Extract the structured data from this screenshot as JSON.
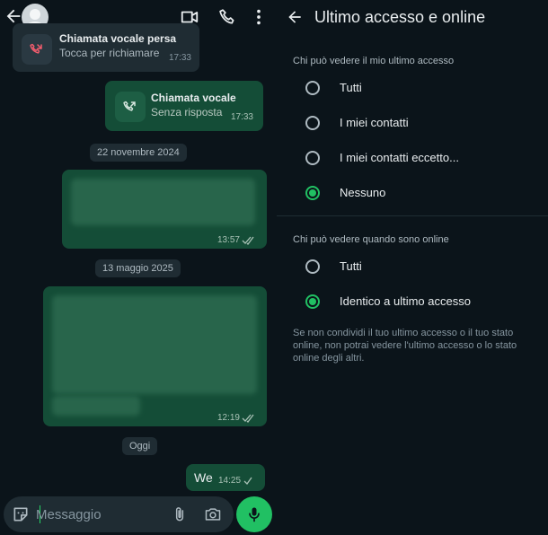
{
  "chat": {
    "missed_call": {
      "title": "Chiamata vocale persa",
      "subtitle": "Tocca per richiamare",
      "time": "17:33"
    },
    "voice_call": {
      "title": "Chiamata vocale",
      "subtitle": "Senza risposta",
      "time": "17:33"
    },
    "date1": "22 novembre 2024",
    "msg1_time": "13:57",
    "date2": "13 maggio 2025",
    "msg2_time": "12:19",
    "date3": "Oggi",
    "msg3": {
      "text": "We",
      "time": "14:25"
    },
    "composer_placeholder": "Messaggio"
  },
  "settings": {
    "title": "Ultimo accesso e online",
    "section1": {
      "title": "Chi può vedere il mio ultimo accesso",
      "options": [
        "Tutti",
        "I miei contatti",
        "I miei contatti eccetto...",
        "Nessuno"
      ],
      "selected": 3
    },
    "section2": {
      "title": "Chi può vedere quando sono online",
      "options": [
        "Tutti",
        "Identico a ultimo accesso"
      ],
      "selected": 1
    },
    "footnote": "Se non condividi il tuo ultimo accesso o il tuo stato online, non potrai vedere l'ultimo accesso o lo stato online degli altri."
  },
  "colors": {
    "accent": "#21c063",
    "outgoing_bubble": "#144d37",
    "incoming_bubble": "#1f2c33",
    "background": "#0b141a",
    "missed_call": "#f15c6d"
  }
}
